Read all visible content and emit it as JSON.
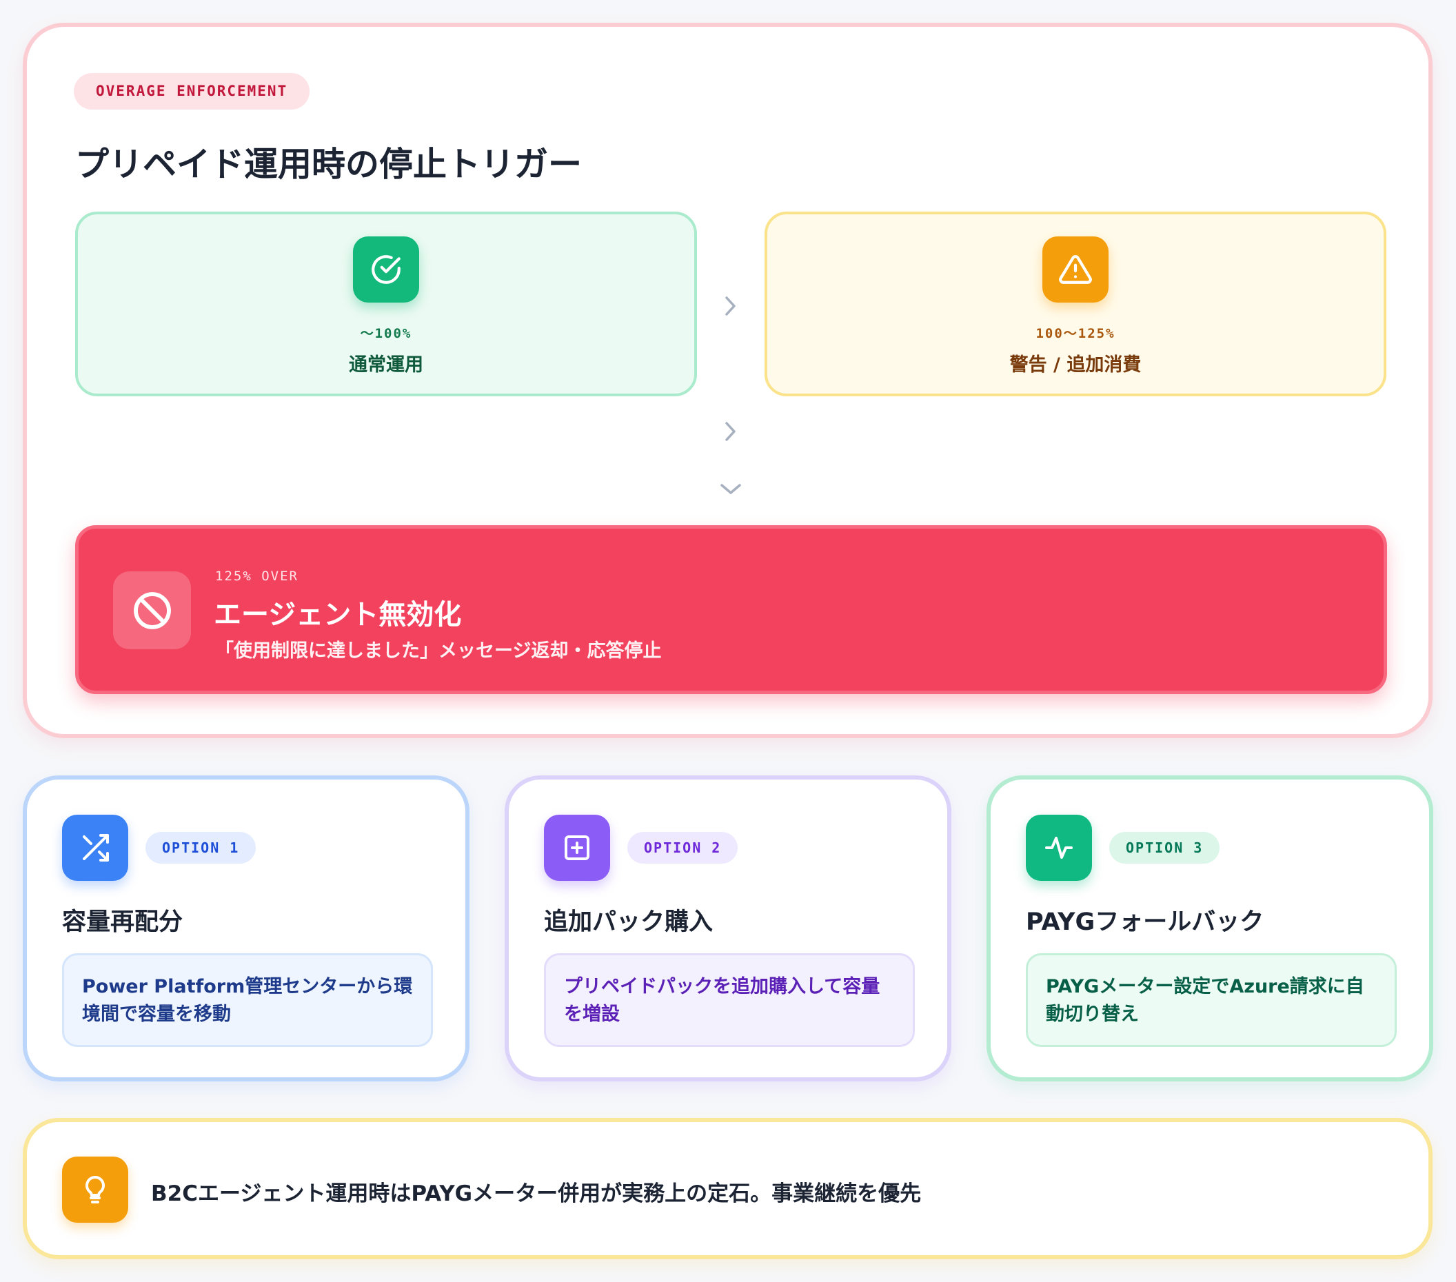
{
  "header": {
    "eyebrow": "OVERAGE ENFORCEMENT",
    "title": "プリペイド運用時の停止トリガー"
  },
  "stages": [
    {
      "range": "～100%",
      "label": "通常運用",
      "icon": "check-circle-icon",
      "color": "#13b97b"
    },
    {
      "range": "100～125%",
      "label": "警告 / 追加消費",
      "icon": "warning-triangle-icon",
      "color": "#f59e0b"
    }
  ],
  "stop": {
    "threshold": "125% OVER",
    "title": "エージェント無効化",
    "description": "「使用制限に達しました」メッセージ返却・応答停止",
    "icon": "prohibited-icon",
    "color": "#f2425e"
  },
  "options": [
    {
      "badge": "OPTION 1",
      "title": "容量再配分",
      "description": "Power Platform管理センターから環境間で容量を移動",
      "icon": "shuffle-icon",
      "color": "#3b82f6"
    },
    {
      "badge": "OPTION 2",
      "title": "追加パック購入",
      "description": "プリペイドパックを追加購入して容量を増設",
      "icon": "plus-square-icon",
      "color": "#8b5cf6"
    },
    {
      "badge": "OPTION 3",
      "title": "PAYGフォールバック",
      "description": "PAYGメーター設定でAzure請求に自動切り替え",
      "icon": "activity-pulse-icon",
      "color": "#10b981"
    }
  ],
  "tip": {
    "text": "B2Cエージェント運用時はPAYGメーター併用が実務上の定石。事業継続を優先",
    "icon": "lightbulb-icon",
    "color": "#f59e0b"
  }
}
